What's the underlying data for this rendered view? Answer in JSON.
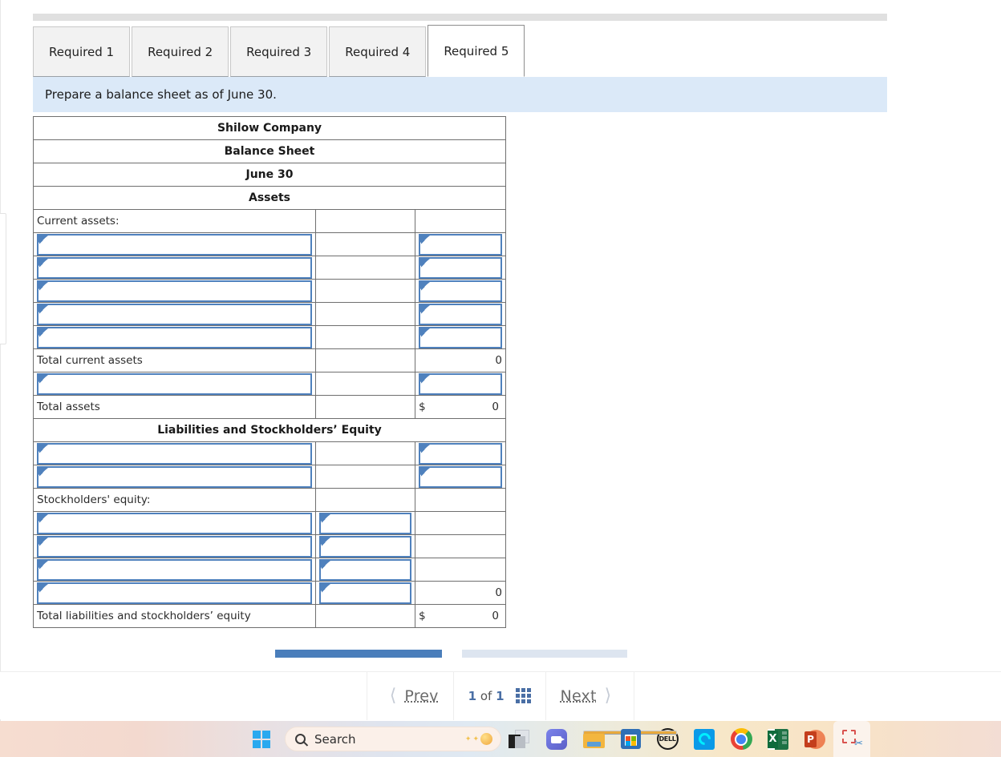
{
  "tabs": [
    {
      "label": "Required 1",
      "active": false
    },
    {
      "label": "Required 2",
      "active": false
    },
    {
      "label": "Required 3",
      "active": false
    },
    {
      "label": "Required 4",
      "active": false
    },
    {
      "label": "Required 5",
      "active": true
    }
  ],
  "instruction": "Prepare a balance sheet as of June 30.",
  "sheet": {
    "title_lines": [
      "Shilow Company",
      "Balance Sheet",
      "June 30"
    ],
    "section_assets": "Assets",
    "section_liabilities": "Liabilities and Stockholders’ Equity",
    "rows": [
      {
        "kind": "label",
        "label": "Current assets:",
        "mid": "",
        "right": ""
      },
      {
        "kind": "input_label_right",
        "label": "",
        "mid": "",
        "right": ""
      },
      {
        "kind": "input_label_right",
        "label": "",
        "mid": "",
        "right": ""
      },
      {
        "kind": "input_label_right",
        "label": "",
        "mid": "",
        "right": ""
      },
      {
        "kind": "input_label_right",
        "label": "",
        "mid": "",
        "right": ""
      },
      {
        "kind": "input_label_right",
        "label": "",
        "mid": "",
        "right": ""
      },
      {
        "kind": "total",
        "label": "Total current assets",
        "mid": "",
        "right": "0"
      },
      {
        "kind": "input_label_right",
        "label": "",
        "mid": "",
        "right": ""
      },
      {
        "kind": "grandtotal",
        "label": "Total assets",
        "mid": "",
        "right": "0",
        "currency": "$"
      }
    ],
    "rows2": [
      {
        "kind": "input_label_right",
        "label": "",
        "mid": "",
        "right": ""
      },
      {
        "kind": "input_label_right",
        "label": "",
        "mid": "",
        "right": ""
      },
      {
        "kind": "label",
        "label": "Stockholders' equity:",
        "mid": "",
        "right": ""
      },
      {
        "kind": "input_label_mid",
        "label": "",
        "mid": "",
        "right": ""
      },
      {
        "kind": "input_label_mid",
        "label": "",
        "mid": "",
        "right": ""
      },
      {
        "kind": "input_label_mid",
        "label": "",
        "mid": "",
        "right": ""
      },
      {
        "kind": "input_label_mid_num",
        "label": "",
        "mid": "",
        "right": "0"
      },
      {
        "kind": "grandtotal",
        "label": "Total liabilities and stockholders’ equity",
        "mid": "",
        "right": "0",
        "currency": "$"
      }
    ]
  },
  "pagination": {
    "prev_label": "Prev",
    "next_label": "Next",
    "current_page": "1",
    "of_label": "of",
    "total_pages": "1",
    "prev_icon": "chevron-left-icon",
    "next_icon": "chevron-right-icon",
    "grid_icon": "grid-view-icon"
  },
  "taskbar": {
    "start_icon": "windows-start-icon",
    "search_placeholder": "Search",
    "search_icon": "search-icon",
    "items": [
      {
        "name": "file-explorer-icon",
        "label": "File Explorer"
      },
      {
        "name": "teams-icon",
        "label": "Microsoft Teams"
      },
      {
        "name": "folder-icon",
        "label": "Folder"
      },
      {
        "name": "microsoft-store-icon",
        "label": "Microsoft Store"
      },
      {
        "name": "dell-icon",
        "label": "DELL"
      },
      {
        "name": "alexa-icon",
        "label": "Alexa"
      },
      {
        "name": "chrome-icon",
        "label": "Google Chrome"
      },
      {
        "name": "excel-icon",
        "label": "Excel"
      },
      {
        "name": "powerpoint-icon",
        "label": "PowerPoint"
      },
      {
        "name": "snipping-tool-icon",
        "label": "Snipping Tool"
      }
    ],
    "dell_text": "DELL",
    "excel_letter": "X",
    "ppt_letter": "P"
  },
  "colors": {
    "header_blue": "#85aee5",
    "instruction_blue": "#dbe9f8",
    "input_border": "#4f81bd",
    "scroll_thumb": "#4a7ebb",
    "accent": "#4a6fa5"
  }
}
